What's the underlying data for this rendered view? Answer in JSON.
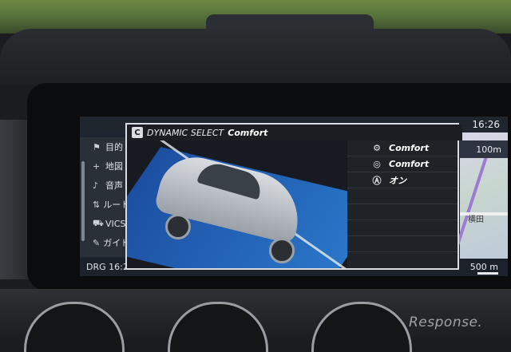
{
  "status": {
    "clock": "16:26"
  },
  "menu": {
    "items": [
      {
        "icon": "flag-icon",
        "glyph": "⚑",
        "label": "目的"
      },
      {
        "icon": "plus-icon",
        "glyph": "+",
        "label": "地図"
      },
      {
        "icon": "speaker-icon",
        "glyph": "♪",
        "label": "音声"
      },
      {
        "icon": "route-icon",
        "glyph": "⇅",
        "label": "ルート"
      },
      {
        "icon": "car-icon",
        "glyph": "⛟",
        "label": "VICS"
      },
      {
        "icon": "wrench-icon",
        "glyph": "✎",
        "label": "ガイド"
      }
    ]
  },
  "map": {
    "distance": "100m",
    "place_label": "横田",
    "bottom_distance": "500 m"
  },
  "bottom": {
    "drg_label": "DRG",
    "time": "16:2"
  },
  "overlay": {
    "badge": "C",
    "title": "DYNAMIC SELECT",
    "mode": "Comfort",
    "settings": [
      {
        "icon": "engine-icon",
        "glyph": "⚙",
        "value": "Comfort"
      },
      {
        "icon": "steering-icon",
        "glyph": "◎",
        "value": "Comfort"
      },
      {
        "icon": "auto-start-stop-icon",
        "glyph": "Ⓐ",
        "value": "オン"
      }
    ]
  },
  "watermark": "Response."
}
